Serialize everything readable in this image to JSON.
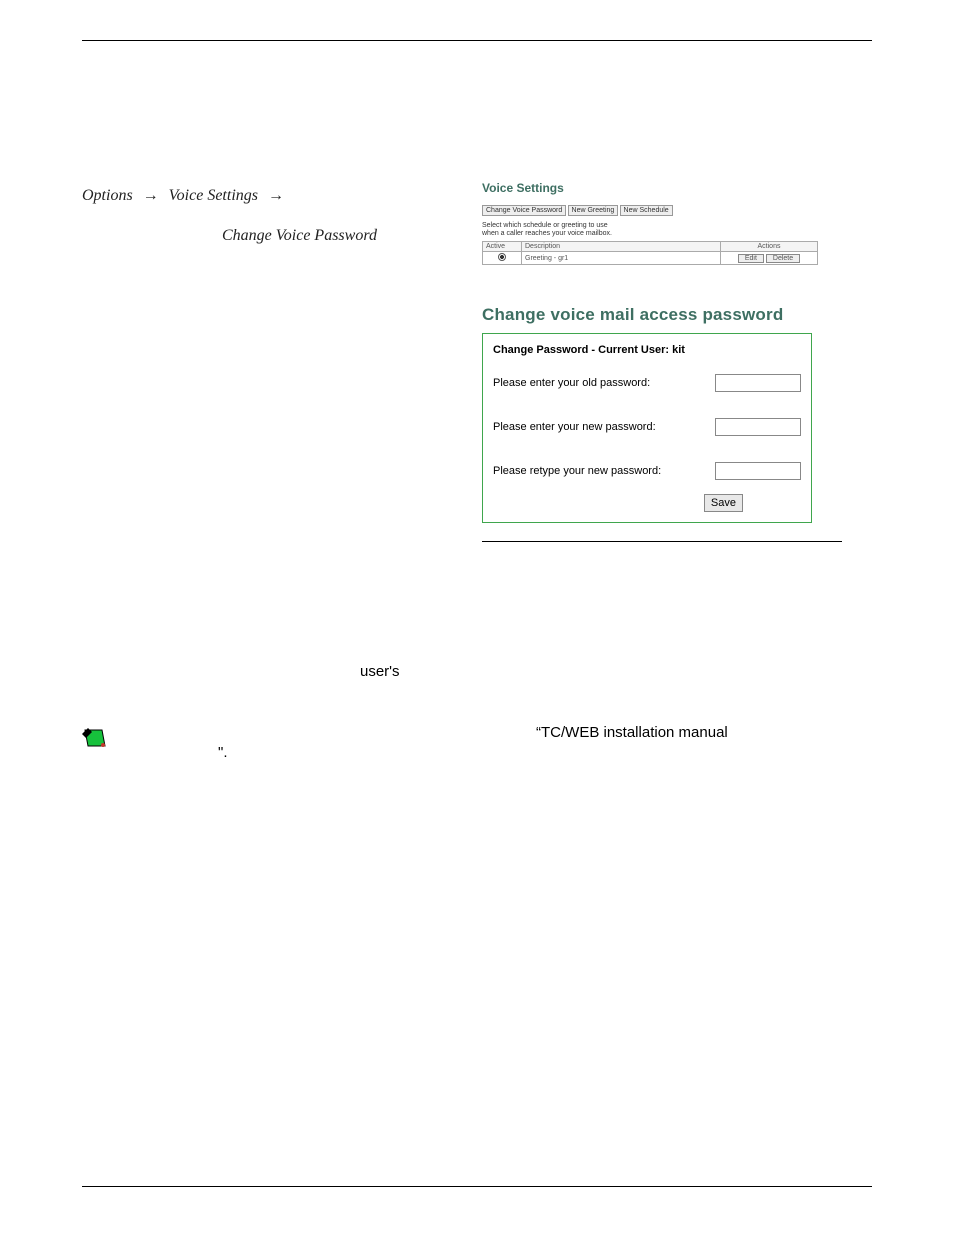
{
  "nav": {
    "options": "Options",
    "voice_settings": "Voice Settings",
    "change_voice_password": "Change Voice Password"
  },
  "voice_settings_panel": {
    "title": "Voice Settings",
    "buttons": {
      "change_voice_password": "Change Voice Password",
      "new_greeting": "New Greeting",
      "new_schedule": "New Schedule"
    },
    "hint_line1": "Select which schedule or greeting to use",
    "hint_line2": "when a caller reaches your voice mailbox.",
    "table": {
      "headers": {
        "active": "Active",
        "description": "Description",
        "actions": "Actions"
      },
      "row": {
        "description": "Greeting - gr1",
        "edit": "Edit",
        "delete": "Delete"
      }
    }
  },
  "change_password": {
    "heading": "Change voice mail access password",
    "box_title": "Change Password - Current User: kit",
    "old_label": "Please enter your old password:",
    "new_label": "Please enter your new password:",
    "retype_label": "Please retype your new password:",
    "save": "Save"
  },
  "body": {
    "fragment": "user's"
  },
  "note": {
    "q1": "“",
    "manual": "TC/WEB installation manual",
    "trail": "\"."
  }
}
